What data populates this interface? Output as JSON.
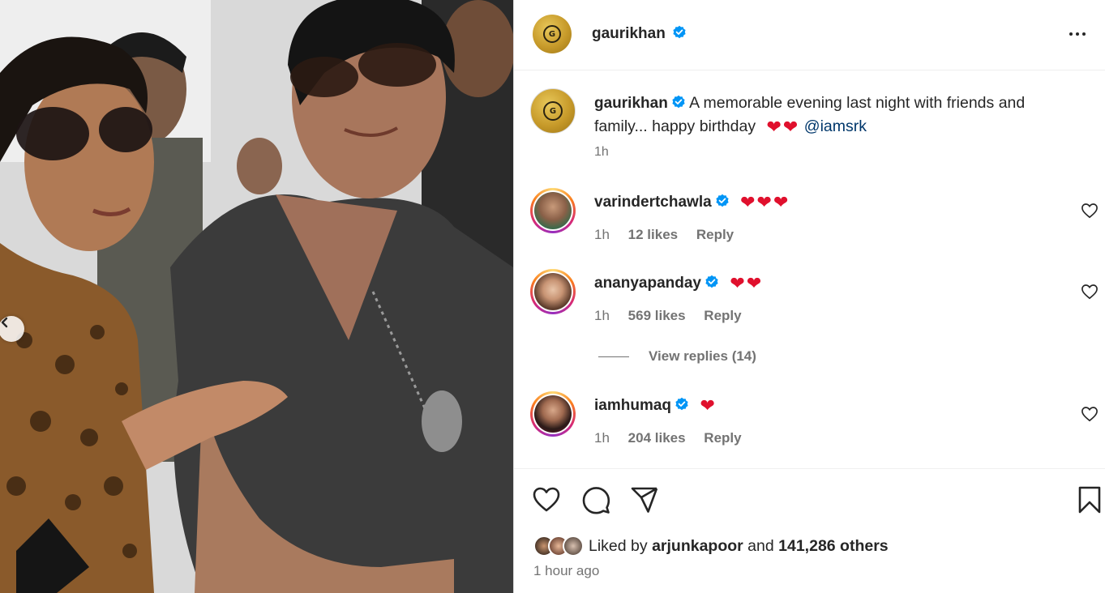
{
  "post": {
    "username": "gaurikhan",
    "logo_glyph": "G"
  },
  "caption": {
    "username": "gaurikhan",
    "text": "A memorable evening last night with friends and family... happy birthday",
    "hearts": "❤❤",
    "mention": "@iamsrk",
    "time": "1h"
  },
  "comments": [
    {
      "username": "varindertchawla",
      "hearts": "❤❤❤",
      "time": "1h",
      "likes": "12 likes",
      "reply": "Reply"
    },
    {
      "username": "ananyapanday",
      "hearts": "❤❤",
      "time": "1h",
      "likes": "569 likes",
      "reply": "Reply"
    },
    {
      "username": "iamhumaq",
      "hearts": "❤",
      "time": "1h",
      "likes": "204 likes",
      "reply": "Reply"
    }
  ],
  "view_replies": "View replies (14)",
  "likes": {
    "prefix": "Liked by",
    "user": "arjunkapoor",
    "middle": "and",
    "others": "141,286 others"
  },
  "post_time": "1 hour ago",
  "icons": {
    "verified": "verified-badge-icon",
    "more": "more-options-icon",
    "like": "heart-icon",
    "comment": "comment-icon",
    "share": "share-icon",
    "save": "bookmark-icon",
    "prev": "chevron-left-icon"
  },
  "colors": {
    "verified": "#0095f6",
    "heart": "#e0102d",
    "mention": "#00376b",
    "muted": "#737373"
  }
}
